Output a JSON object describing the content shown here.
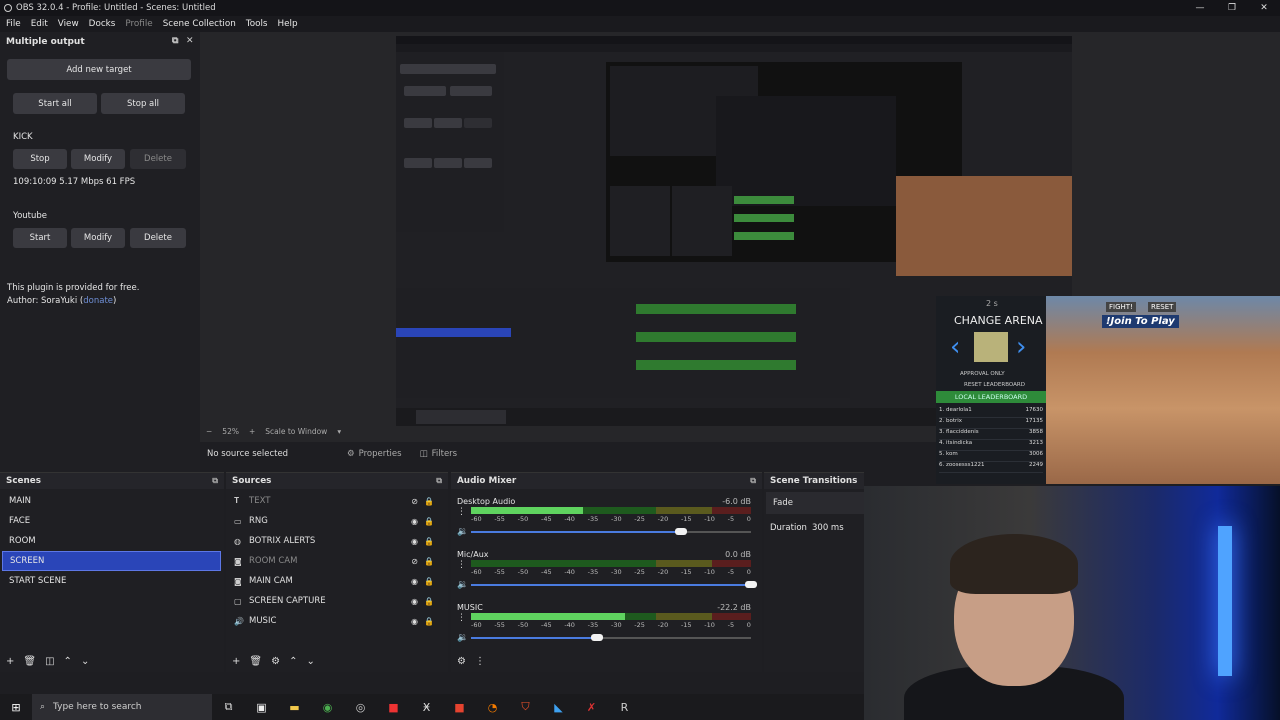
{
  "window": {
    "title": "OBS 32.0.4 - Profile: Untitled - Scenes: Untitled",
    "controls": [
      "—",
      "❐",
      "✕"
    ]
  },
  "menu": [
    "File",
    "Edit",
    "View",
    "Docks",
    "Profile",
    "Scene Collection",
    "Tools",
    "Help"
  ],
  "multiple_output": {
    "title": "Multiple output",
    "add_target": "Add new target",
    "start_all": "Start all",
    "stop_all": "Stop all",
    "targets": [
      {
        "name": "KICK",
        "btn1": "Stop",
        "modify": "Modify",
        "delete": "Delete",
        "status": "109:10:09  5.17 Mbps  61 FPS"
      },
      {
        "name": "Youtube",
        "btn1": "Start",
        "modify": "Modify",
        "delete": "Delete"
      }
    ],
    "footer_line1": "This plugin is provided for free.",
    "footer_author": "Author: SoraYuki (",
    "footer_link": "donate",
    "footer_close": ")"
  },
  "preview": {
    "zoom": "52%",
    "scale_mode": "Scale to Window",
    "no_source": "No source selected",
    "properties": "Properties",
    "filters": "Filters"
  },
  "overlay": {
    "title": "CHANGE ARENA",
    "timer": "2 s",
    "fight": "FIGHT!",
    "reset": "RESET",
    "join": "!Join To Play",
    "approval": "APPROVAL ONLY",
    "reset_lb": "RESET LEADERBOARD",
    "local_lb": "LOCAL LEADERBOARD",
    "leaderboard": [
      {
        "name": "1. dearlola1",
        "score": "17630"
      },
      {
        "name": "2. botrix",
        "score": "17135"
      },
      {
        "name": "3. flacciddenis",
        "score": "3858"
      },
      {
        "name": "4. itsindicka",
        "score": "3213"
      },
      {
        "name": "5. kom",
        "score": "3006"
      },
      {
        "name": "6. zoosesss1221",
        "score": "2249"
      }
    ]
  },
  "scenes": {
    "title": "Scenes",
    "items": [
      "MAIN",
      "FACE",
      "ROOM",
      "SCREEN",
      "START SCENE"
    ],
    "selected": "SCREEN"
  },
  "sources": {
    "title": "Sources",
    "items": [
      {
        "name": "TEXT",
        "icon": "text-icon",
        "visible": false
      },
      {
        "name": "RNG",
        "icon": "window-icon",
        "visible": true
      },
      {
        "name": "BOTRIX ALERTS",
        "icon": "globe-icon",
        "visible": true
      },
      {
        "name": "ROOM CAM",
        "icon": "camera-icon",
        "visible": false
      },
      {
        "name": "MAIN CAM",
        "icon": "camera-icon",
        "visible": true
      },
      {
        "name": "SCREEN CAPTURE",
        "icon": "monitor-icon",
        "visible": true
      },
      {
        "name": "MUSIC",
        "icon": "speaker-icon",
        "visible": true
      }
    ]
  },
  "mixer": {
    "title": "Audio Mixer",
    "scale": [
      "-60",
      "-55",
      "-50",
      "-45",
      "-40",
      "-35",
      "-30",
      "-25",
      "-20",
      "-15",
      "-10",
      "-5",
      "0"
    ],
    "channels": [
      {
        "name": "Desktop Audio",
        "db": "-6.0 dB",
        "level": 0.4,
        "volume": 0.75
      },
      {
        "name": "Mic/Aux",
        "db": "0.0 dB",
        "level": 0.0,
        "volume": 1.0
      },
      {
        "name": "MUSIC",
        "db": "-22.2 dB",
        "level": 0.55,
        "volume": 0.45
      }
    ]
  },
  "transitions": {
    "title": "Scene Transitions",
    "type": "Fade",
    "duration_label": "Duration",
    "duration_value": "300 ms"
  },
  "taskbar": {
    "search_placeholder": "Type here to search"
  },
  "colors": {
    "selection": "#2a45b8",
    "meter_green": "#5fd35f",
    "accent_blue": "#4a7be0"
  }
}
